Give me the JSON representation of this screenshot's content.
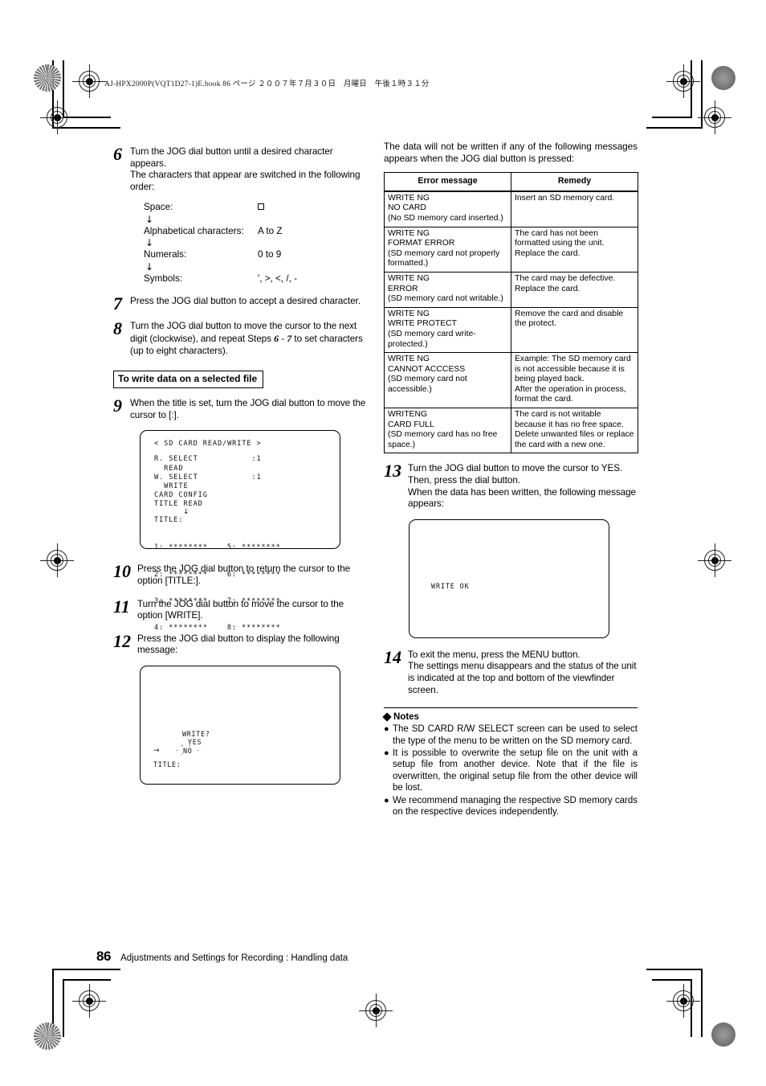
{
  "slug": "AJ-HPX2000P(VQT1D27-1)E.book  86 ページ  ２００７年７月３０日　月曜日　午後１時３１分",
  "left_column": {
    "step6": {
      "number": "6",
      "line1": "Turn the JOG dial button until a desired character appears.",
      "line2": "The characters that appear are switched in the following order:",
      "char_order": [
        {
          "label": "Space:",
          "value": "□"
        },
        {
          "label": "Alphabetical characters:",
          "value": "A to Z"
        },
        {
          "label": "Numerals:",
          "value": "0 to 9"
        },
        {
          "label": "Symbols:",
          "value": "', >, <, /, -"
        }
      ],
      "arrow": "↓"
    },
    "step7": {
      "number": "7",
      "text": "Press the JOG dial button to accept a desired character."
    },
    "step8": {
      "number": "8",
      "text_a": "Turn the JOG dial button to move the cursor to the next digit (clockwise), and repeat Steps ",
      "em_a": "6",
      "dash": " - ",
      "em_b": "7",
      "text_b": " to set characters (up to eight characters)."
    },
    "subheading": "To write data on a selected file",
    "step9": {
      "number": "9",
      "text": "When the title is set, turn the JOG dial button to move the cursor to [:]."
    },
    "screen1": {
      "title": "< SD CARD READ/WRITE >",
      "rows": [
        "R. SELECT           :1",
        "  READ",
        "W. SELECT           :1",
        "  WRITE",
        "CARD CONFIG",
        "TITLE READ"
      ],
      "arrow": "↓",
      "title_label": "TITLE:",
      "col_left": [
        "1: ********",
        "2: ********",
        "3: ********",
        "4: ********"
      ],
      "col_right": [
        "5: ********",
        "6: ********",
        "7: ********",
        "8: ********"
      ]
    },
    "step10": {
      "number": "10",
      "text": "Press the JOG dial button to return the cursor to the option [TITLE:]."
    },
    "step11": {
      "number": "11",
      "text": "Turn the JOG dial button to move the cursor to the option [WRITE]."
    },
    "step12": {
      "number": "12",
      "text": "Press the JOG dial button to display the following message:"
    },
    "screen2": {
      "prompt": "WRITE?",
      "yes": "YES",
      "no": "NO",
      "cursor": "→",
      "title_label": "TITLE:"
    }
  },
  "right_column": {
    "intro": "The data will not be written if any of the following messages appears when the JOG dial button is pressed:",
    "table": {
      "headers": [
        "Error message",
        "Remedy"
      ],
      "rows": [
        {
          "error": "WRITE NG\nNO CARD\n(No SD memory card inserted.)",
          "remedy": "Insert an SD memory card."
        },
        {
          "error": "WRITE NG\nFORMAT ERROR\n(SD memory card not properly formatted.)",
          "remedy": "The card has not been formatted using the unit. Replace the card."
        },
        {
          "error": "WRITE NG\nERROR\n(SD memory card not writable.)",
          "remedy": "The card may be defective. Replace the card."
        },
        {
          "error": "WRITE NG\nWRITE PROTECT\n(SD memory card write-protected.)",
          "remedy": ""
        },
        {
          "error": "WRITE NG\nCANNOT ACCCESS\n(SD memory card not accessible.)",
          "remedy": "Example: The SD memory card is not accessible because it is being played back.\nAfter the operation in process, format the card."
        },
        {
          "error": "WRITENG\nCARD FULL\n(SD memory card has no free space.)",
          "remedy": "The card is not writable because it has no free space. Delete unwanted files or replace the card with a new one."
        }
      ],
      "row4_remedy": "Remove the card and disable the protect."
    },
    "step13": {
      "number": "13",
      "text": "Turn the JOG dial button to move the cursor to YES. Then, press the dial button.\nWhen the data has been written, the following message appears:"
    },
    "screen3": {
      "message": "WRITE OK"
    },
    "step14": {
      "number": "14",
      "text": "To exit the menu, press the MENU button.\nThe settings menu disappears and the status of the unit is indicated at the top and bottom of the viewfinder screen."
    },
    "notes": {
      "heading": "Notes",
      "bullet": "●",
      "items": [
        "The SD CARD R/W SELECT screen can be used to select the type of the menu to be written on the SD memory card.",
        "It is possible to overwrite the setup file on the unit with a setup file from another device. Note that if the file is overwritten, the original setup file from the other device will be lost.",
        "We recommend managing the respective SD memory cards on the respective devices independently."
      ]
    }
  },
  "footer": {
    "page_number": "86",
    "text": "Adjustments and Settings for Recording : Handling data"
  }
}
